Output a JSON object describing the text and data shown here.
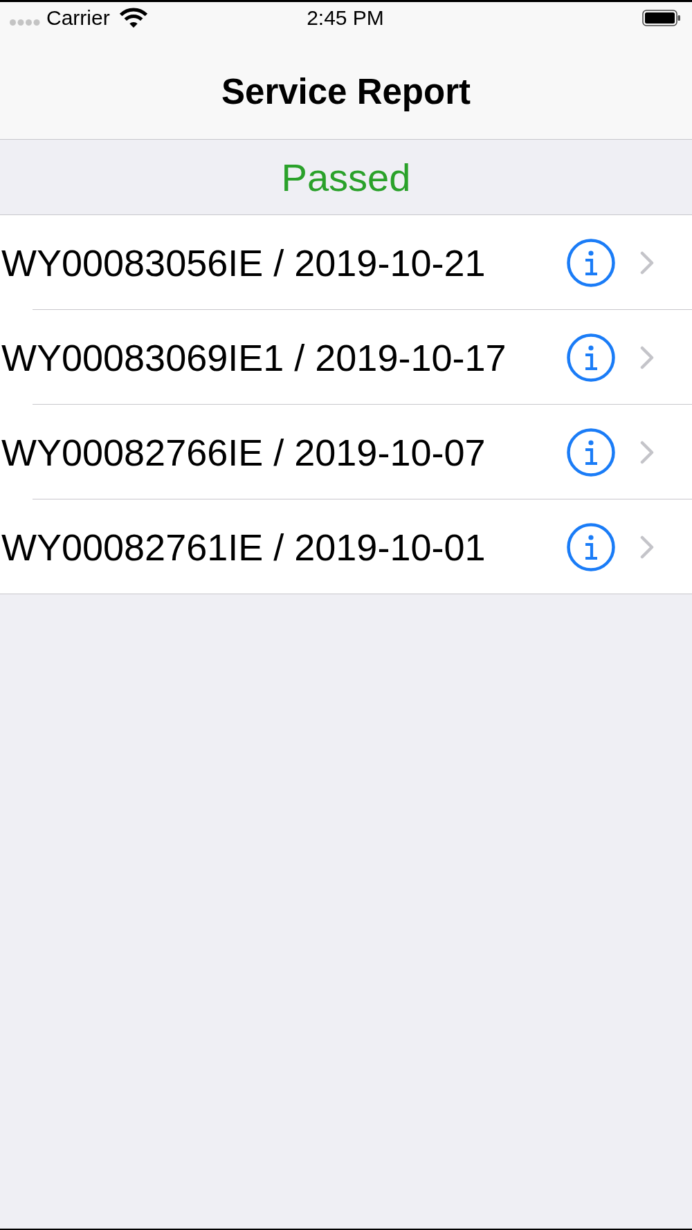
{
  "status_bar": {
    "carrier": "Carrier",
    "time": "2:45 PM"
  },
  "nav_bar": {
    "title": "Service Report"
  },
  "sections": [
    {
      "header": "Passed",
      "rows": [
        {
          "label": "WY00083056IE / 2019-10-21"
        },
        {
          "label": "WY00083069IE1 / 2019-10-17"
        },
        {
          "label": "WY00082766IE / 2019-10-07"
        },
        {
          "label": "WY00082761IE / 2019-10-01"
        }
      ]
    }
  ]
}
